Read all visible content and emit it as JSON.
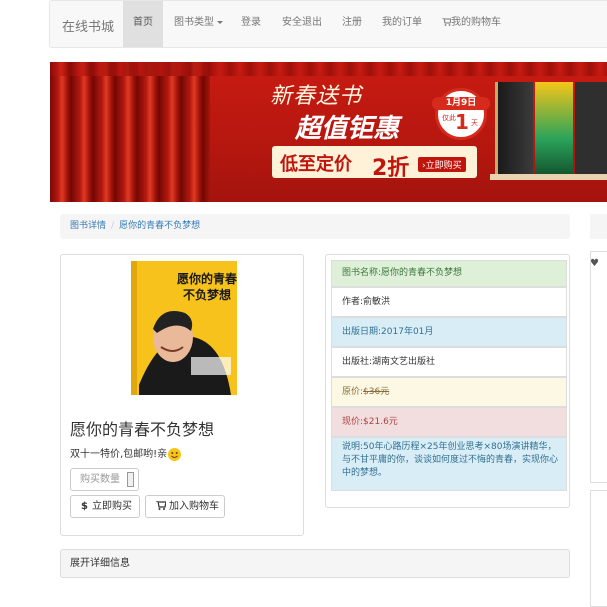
{
  "navbar": {
    "brand": "在线书城",
    "items": [
      "首页",
      "图书类型",
      "登录",
      "安全退出",
      "注册",
      "我的订单",
      "我的购物车"
    ]
  },
  "banner": {
    "line1": "新春送书",
    "line2": "超值钜惠",
    "date": "1月9日",
    "only": "仅此",
    "day_num": "1",
    "day": "天",
    "price_lead": "低至定价",
    "discount": "2折",
    "cta": "›立即购买"
  },
  "breadcrumb": {
    "home": "图书详情",
    "current": "愿你的青春不负梦想"
  },
  "product": {
    "cover_title": "愿你的青春不负梦想",
    "title": "愿你的青春不负梦想",
    "subtitle": "双十一特价,包邮哟!亲",
    "qty_placeholder": "购买数量",
    "buy_label": "立即购买",
    "cart_label": "加入购物车"
  },
  "info": {
    "name_label": "图书名称:",
    "name": "愿你的青春不负梦想",
    "author_label": "作者:",
    "author": "俞敏洪",
    "date_label": "出版日期:",
    "date": "2017年01月",
    "publisher_label": "出版社:",
    "publisher": "湖南文艺出版社",
    "orig_label": "原价:",
    "orig_price": "$36元",
    "now_label": "现价:",
    "now_price": "$21.6元",
    "desc_label": "说明:",
    "desc": "50年心路历程×25年创业思考×80场演讲精华，与不甘平庸的你，谈谈如何度过不悔的青春，实现你心中的梦想。"
  },
  "detail_panel": "展开详细信息",
  "colors": {
    "link": "#337ab7",
    "banner_red": "#c81b12"
  }
}
